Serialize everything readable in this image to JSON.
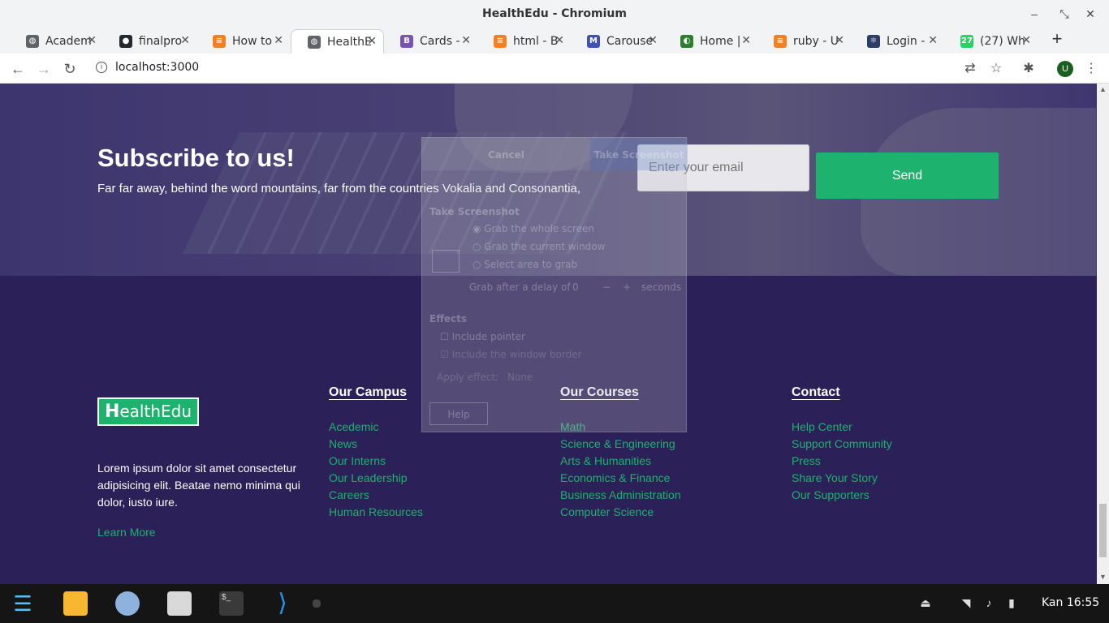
{
  "window": {
    "title": "HealthEdu - Chromium"
  },
  "tabs": [
    {
      "label": "Academ",
      "favicon": "globe-icon",
      "color": "#5f6368",
      "glyph": "◍"
    },
    {
      "label": "finalpro",
      "favicon": "github-icon",
      "color": "#24292e",
      "glyph": "●"
    },
    {
      "label": "How to",
      "favicon": "stackoverflow-icon",
      "color": "#f48024",
      "glyph": "≡"
    },
    {
      "label": "HealthE",
      "favicon": "globe-icon",
      "color": "#5f6368",
      "glyph": "◍",
      "active": true
    },
    {
      "label": "Cards -",
      "favicon": "bootstrap-icon",
      "color": "#7952b3",
      "glyph": "B"
    },
    {
      "label": "html - B",
      "favicon": "stackoverflow-icon",
      "color": "#f48024",
      "glyph": "≡"
    },
    {
      "label": "Carouse",
      "favicon": "mdb-icon",
      "color": "#3f51b5",
      "glyph": "M"
    },
    {
      "label": "Home |",
      "favicon": "edge-icon",
      "color": "#2e7d32",
      "glyph": "◐"
    },
    {
      "label": "ruby - U",
      "favicon": "stackoverflow-icon",
      "color": "#f48024",
      "glyph": "≡"
    },
    {
      "label": "Login -",
      "favicon": "react-icon",
      "color": "#2c3e66",
      "glyph": "⚛"
    },
    {
      "label": "(27) Wh",
      "favicon": "whatsapp-icon",
      "color": "#25d366",
      "glyph": "27"
    }
  ],
  "address": {
    "url": "localhost:3000",
    "avatar_letter": "U"
  },
  "hero": {
    "title": "Subscribe to us!",
    "text": "Far far away, behind the word mountains, far from the countries Vokalia and Consonantia,",
    "email_placeholder": "Enter your email",
    "send_label": "Send"
  },
  "footer": {
    "logo_first": "H",
    "logo_rest": "ealthEdu",
    "about": "Lorem ipsum dolor sit amet consectetur adipisicing elit. Beatae nemo minima qui dolor, iusto iure.",
    "learn_more": "Learn More",
    "campus": {
      "title": "Our Campus",
      "links": [
        "Acedemic",
        "News",
        "Our Interns",
        "Our Leadership",
        "Careers",
        "Human Resources"
      ]
    },
    "courses": {
      "title": "Our Courses",
      "links": [
        "Math",
        "Science & Engineering",
        "Arts & Humanities",
        "Economics & Finance",
        "Business Administration",
        "Computer Science"
      ]
    },
    "contact": {
      "title": "Contact",
      "links": [
        "Help Center",
        "Support Community",
        "Press",
        "Share Your Story",
        "Our Supporters"
      ]
    }
  },
  "screenshot_dialog": {
    "cancel": "Cancel",
    "take": "Take Screenshot",
    "section": "Take Screenshot",
    "opt1": "Grab the whole screen",
    "opt2": "Grab the current window",
    "opt3": "Select area to grab",
    "delay_label": "Grab after a delay of",
    "delay_value": "0",
    "delay_unit": "seconds",
    "effects": "Effects",
    "include_pointer": "Include pointer",
    "include_border": "Include the window border",
    "apply_effect": "Apply effect:",
    "effect_value": "None",
    "help": "Help"
  },
  "taskbar": {
    "clock": "Kan 16:55"
  }
}
